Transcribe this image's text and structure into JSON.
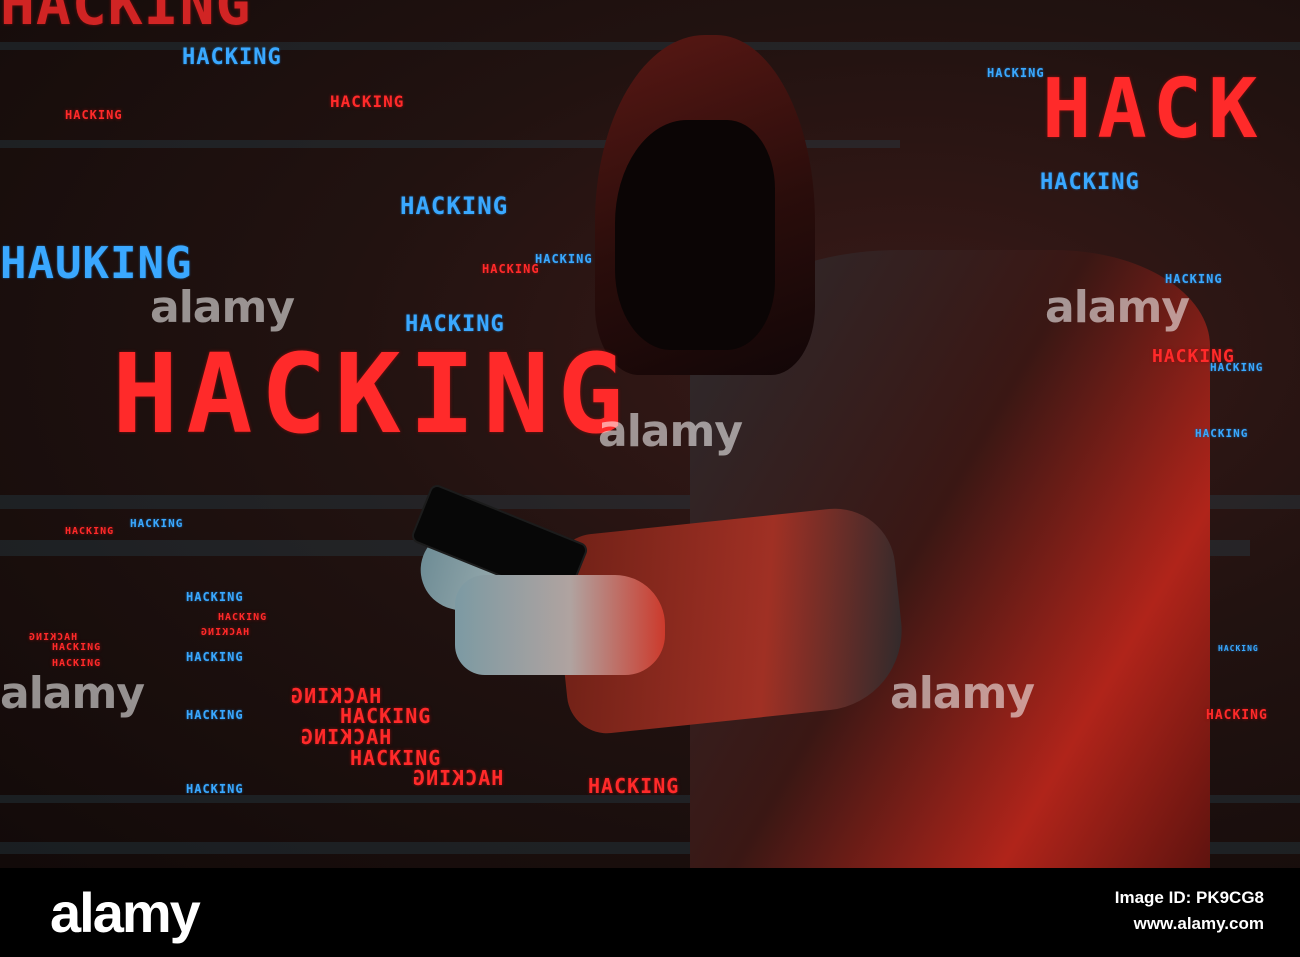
{
  "photo": {
    "words": {
      "hacking": "HACKING",
      "hack_partial": "HACK",
      "hauking_glitch": "HAUKING",
      "mirror": "HACKING"
    },
    "watermark": "alamy"
  },
  "footer": {
    "logo": "alamy",
    "image_id": "Image ID: PK9CG8",
    "site": "www.alamy.com"
  },
  "colors": {
    "blue": "#3aa8ff",
    "red": "#ff2a2a",
    "footer_bg": "#000000"
  }
}
